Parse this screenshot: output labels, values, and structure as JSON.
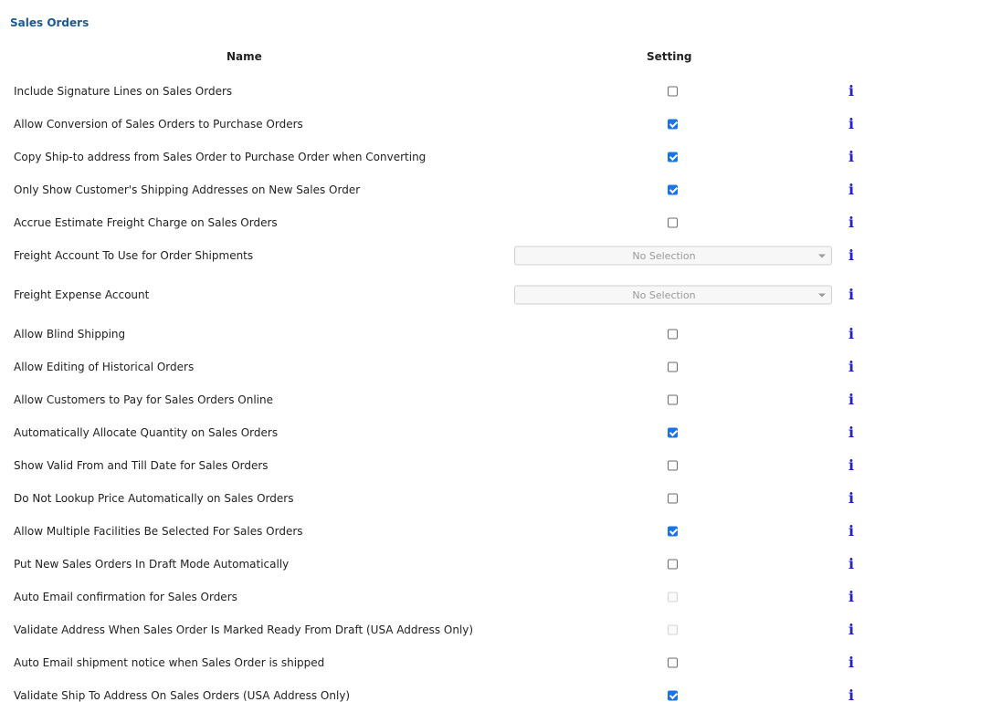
{
  "section": {
    "title": "Sales Orders"
  },
  "columns": {
    "name": "Name",
    "setting": "Setting"
  },
  "colors": {
    "title": "#1b5a96",
    "checkbox_checked": "#1a73e8",
    "info_icon": "#2222c8"
  },
  "rows": [
    {
      "label": "Include Signature Lines on Sales Orders",
      "control": "checkbox",
      "state": "unchecked",
      "icon": "info-icon"
    },
    {
      "label": "Allow Conversion of Sales Orders to Purchase Orders",
      "control": "checkbox",
      "state": "checked",
      "icon": "info-icon"
    },
    {
      "label": "Copy Ship-to address from Sales Order to Purchase Order when Converting",
      "control": "checkbox",
      "state": "checked",
      "icon": "info-icon"
    },
    {
      "label": "Only Show Customer's Shipping Addresses on New Sales Order",
      "control": "checkbox",
      "state": "checked",
      "icon": "info-icon"
    },
    {
      "label": "Accrue Estimate Freight Charge on Sales Orders",
      "control": "checkbox",
      "state": "unchecked",
      "icon": "info-icon"
    },
    {
      "label": "Freight Account To Use for Order Shipments",
      "control": "select",
      "value": "No Selection",
      "icon": "info-icon"
    },
    {
      "label": "Freight Expense Account",
      "control": "select",
      "value": "No Selection",
      "icon": "info-icon"
    },
    {
      "label": "Allow Blind Shipping",
      "control": "checkbox",
      "state": "unchecked",
      "icon": "info-icon"
    },
    {
      "label": "Allow Editing of Historical Orders",
      "control": "checkbox",
      "state": "unchecked",
      "icon": "info-icon"
    },
    {
      "label": "Allow Customers to Pay for Sales Orders Online",
      "control": "checkbox",
      "state": "unchecked",
      "icon": "info-icon"
    },
    {
      "label": "Automatically Allocate Quantity on Sales Orders",
      "control": "checkbox",
      "state": "checked",
      "icon": "info-icon"
    },
    {
      "label": "Show Valid From and Till Date for Sales Orders",
      "control": "checkbox",
      "state": "unchecked",
      "icon": "info-icon"
    },
    {
      "label": "Do Not Lookup Price Automatically on Sales Orders",
      "control": "checkbox",
      "state": "unchecked",
      "icon": "info-icon"
    },
    {
      "label": "Allow Multiple Facilities Be Selected For Sales Orders",
      "control": "checkbox",
      "state": "checked",
      "icon": "info-icon"
    },
    {
      "label": "Put New Sales Orders In Draft Mode Automatically",
      "control": "checkbox",
      "state": "unchecked",
      "icon": "info-icon"
    },
    {
      "label": "Auto Email confirmation for Sales Orders",
      "control": "checkbox",
      "state": "disabled",
      "icon": "info-icon"
    },
    {
      "label": "Validate Address When Sales Order Is Marked Ready From Draft (USA Address Only)",
      "control": "checkbox",
      "state": "disabled",
      "icon": "info-icon"
    },
    {
      "label": "Auto Email shipment notice when Sales Order is shipped",
      "control": "checkbox",
      "state": "unchecked",
      "icon": "info-icon"
    },
    {
      "label": "Validate Ship To Address On Sales Orders (USA Address Only)",
      "control": "checkbox",
      "state": "checked",
      "icon": "info-icon"
    }
  ]
}
